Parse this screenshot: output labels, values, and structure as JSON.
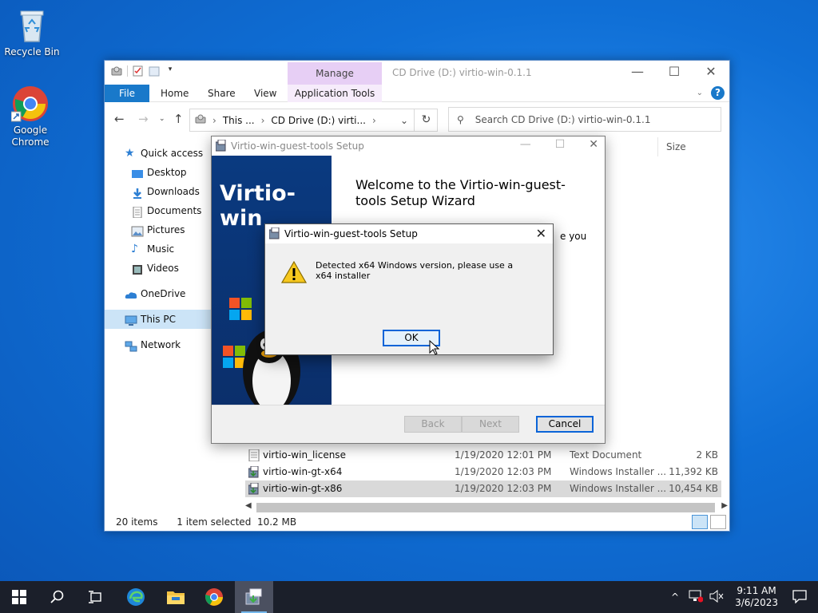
{
  "desktop": {
    "icons": [
      {
        "label": "Recycle Bin"
      },
      {
        "label": "Google\nChrome"
      }
    ]
  },
  "explorer": {
    "title": "CD Drive (D:) virtio-win-0.1.1",
    "manage_label": "Manage",
    "ribbon_tabs": [
      "File",
      "Home",
      "Share",
      "View",
      "Application Tools"
    ],
    "address": {
      "segment1": "This ...",
      "segment2": "CD Drive (D:) virti..."
    },
    "search_placeholder": "Search CD Drive (D:) virtio-win-0.1.1",
    "column_size": "Size",
    "sidebar": [
      {
        "label": "Quick access"
      },
      {
        "label": "Desktop"
      },
      {
        "label": "Downloads"
      },
      {
        "label": "Documents"
      },
      {
        "label": "Pictures"
      },
      {
        "label": "Music"
      },
      {
        "label": "Videos"
      },
      {
        "label": "OneDrive"
      },
      {
        "label": "This PC"
      },
      {
        "label": "Network"
      }
    ],
    "files": [
      {
        "name": "virtio-win_license",
        "date": "1/19/2020 12:01 PM",
        "type": "Text Document",
        "size": "2 KB"
      },
      {
        "name": "virtio-win-gt-x64",
        "date": "1/19/2020 12:03 PM",
        "type": "Windows Installer ...",
        "size": "11,392 KB"
      },
      {
        "name": "virtio-win-gt-x86",
        "date": "1/19/2020 12:03 PM",
        "type": "Windows Installer ...",
        "size": "10,454 KB"
      }
    ],
    "status": {
      "items": "20 items",
      "selected": "1 item selected  10.2 MB"
    }
  },
  "wizard": {
    "title": "Virtio-win-guest-tools Setup",
    "banner_text": "Virtio-win",
    "heading": "Welcome to the Virtio-win-guest-tools Setup Wizard",
    "partial_text": "e you",
    "buttons": {
      "back": "Back",
      "next": "Next",
      "cancel": "Cancel"
    }
  },
  "alert": {
    "title": "Virtio-win-guest-tools Setup",
    "message": "Detected x64 Windows version, please use a x64 installer",
    "ok": "OK"
  },
  "taskbar": {
    "time": "9:11 AM",
    "date": "3/6/2023"
  },
  "colors": {
    "accent": "#1979ca",
    "manage_tab": "#e7cff5",
    "wizard_banner": "#0a3a80",
    "taskbar": "#1b1f2a"
  }
}
